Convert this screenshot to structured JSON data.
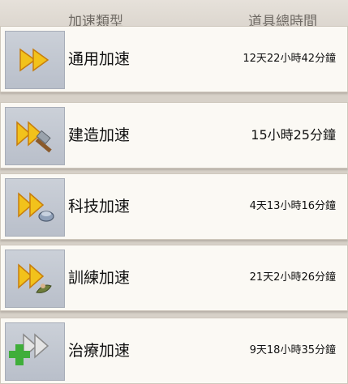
{
  "header": {
    "type_label": "加速類型",
    "time_label": "道具總時間"
  },
  "rows": [
    {
      "label": "通用加速",
      "time": "12天22小時42分鐘",
      "icon": "double-arrow-icon"
    },
    {
      "label": "建造加速",
      "time": "15小時25分鐘",
      "icon": "hammer-speedup-icon"
    },
    {
      "label": "科技加速",
      "time": "4天13小時16分鐘",
      "icon": "research-speedup-icon"
    },
    {
      "label": "訓練加速",
      "time": "21天2小時26分鐘",
      "icon": "training-speedup-icon"
    },
    {
      "label": "治療加速",
      "time": "9天18小時35分鐘",
      "icon": "healing-speedup-icon"
    }
  ],
  "colors": {
    "arrow_yellow": "#f2c21b",
    "arrow_orange": "#e08a12",
    "heal_green": "#3fae3a"
  }
}
